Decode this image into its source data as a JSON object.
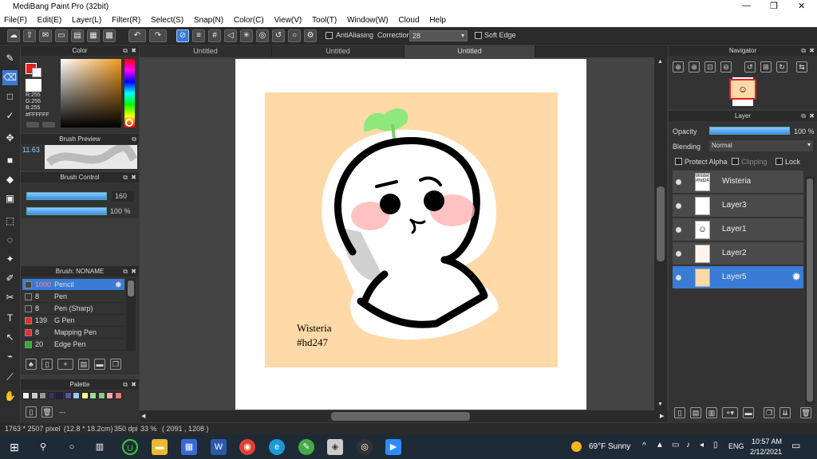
{
  "app": {
    "title": "MediBang Paint Pro (32bit)",
    "minimize": "—",
    "maximize": "❐",
    "close": "✕"
  },
  "menu": [
    "File(F)",
    "Edit(E)",
    "Layer(L)",
    "Filter(R)",
    "Select(S)",
    "Snap(N)",
    "Color(C)",
    "View(V)",
    "Tool(T)",
    "Window(W)",
    "Cloud",
    "Help"
  ],
  "toolbar": {
    "antialiasing_label": "AntiAliasing",
    "correction_label": "Correction",
    "correction_value": "28",
    "soft_edge_label": "Soft Edge"
  },
  "color_panel": {
    "title": "Color",
    "r": "R:255",
    "g": "G:255",
    "b": "B:255",
    "hex": "#FFFFFF"
  },
  "brush_preview": {
    "title": "Brush Preview",
    "size": "11.63"
  },
  "brush_control": {
    "title": "Brush Control",
    "size_value": "160",
    "opacity_value": "100 %"
  },
  "brush_list": {
    "title": "Brush: NONAME",
    "items": [
      {
        "size": "1000",
        "name": "Pencil",
        "color": "#444444"
      },
      {
        "size": "8",
        "name": "Pen",
        "color": "#333333"
      },
      {
        "size": "8",
        "name": "Pen (Sharp)",
        "color": "#333333"
      },
      {
        "size": "139",
        "name": "G Pen",
        "color": "#e03030"
      },
      {
        "size": "8",
        "name": "Mapping Pen",
        "color": "#e03030"
      },
      {
        "size": "20",
        "name": "Edge Pen",
        "color": "#30b030"
      }
    ]
  },
  "palette": {
    "title": "Palette",
    "dash": "---",
    "colors": [
      "#ffffff",
      "#cccccc",
      "#999999",
      "#333366",
      "#222244",
      "#5555aa",
      "#99ccee",
      "#ffff99",
      "#99dd99",
      "#88cc88",
      "#ffaaaa",
      "#ff7777"
    ]
  },
  "tabs": [
    "Untitled",
    "Untitled",
    "Untitled"
  ],
  "artwork": {
    "text_line1": "Wisteria",
    "text_line2": "#hd247"
  },
  "status": {
    "dimensions": "1763 * 2507 pixel",
    "size_cm": "(12.8 * 18.2cm)",
    "dpi": "350 dpi",
    "zoom": "33 %",
    "coords": "( 2091 , 1208 )"
  },
  "navigator": {
    "title": "Navigator"
  },
  "layer_panel": {
    "title": "Layer",
    "opacity_label": "Opacity",
    "opacity_value": "100 %",
    "blending_label": "Blending",
    "blending_value": "Normal",
    "protect_alpha": "Protect Alpha",
    "clipping": "Clipping",
    "lock": "Lock",
    "layers": [
      {
        "name": "Wisteria",
        "thumb_text": "Wisteria #hd247"
      },
      {
        "name": "Layer3",
        "thumb_text": ""
      },
      {
        "name": "Layer1",
        "thumb_text": ""
      },
      {
        "name": "Layer2",
        "thumb_text": ""
      },
      {
        "name": "Layer5",
        "thumb_text": ""
      }
    ]
  },
  "taskbar": {
    "weather": "69°F  Sunny",
    "lang": "ENG",
    "time": "10:57 AM",
    "date": "2/12/2021"
  }
}
